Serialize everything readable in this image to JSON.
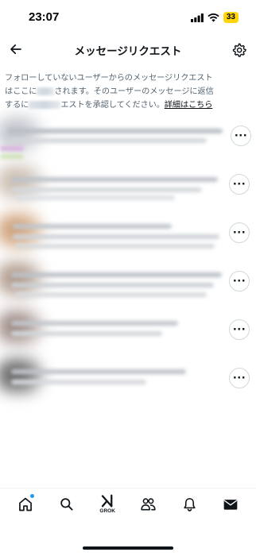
{
  "status_bar": {
    "time": "23:07",
    "battery": "33"
  },
  "header": {
    "title": "メッセージリクエスト"
  },
  "description": {
    "line1": "フォローしていないユーザーからのメッセージリクエスト",
    "line2_a": "はここに",
    "line2_b": "されます。そのユーザーのメッセージに返信",
    "line3_a": "するに",
    "line3_b": "エストを承認してください。",
    "link": "詳細はこちら"
  },
  "requests": [
    {
      "avatar_color": "#b8bcc4"
    },
    {
      "avatar_color": "#c9b8a8"
    },
    {
      "avatar_color": "#c89870"
    },
    {
      "avatar_color": "#a89080"
    },
    {
      "avatar_color": "#8f7a74"
    },
    {
      "avatar_color": "#5a5a5a"
    }
  ],
  "bottom_nav": {
    "grok_label": "GROK",
    "items": [
      "home-icon",
      "search-icon",
      "grok-icon",
      "communities-icon",
      "notifications-icon",
      "messages-icon"
    ]
  },
  "colors": {
    "accent": "#1d9bf0",
    "text": "#0f1419",
    "subtext": "#536471",
    "battery": "#ffd60a"
  }
}
